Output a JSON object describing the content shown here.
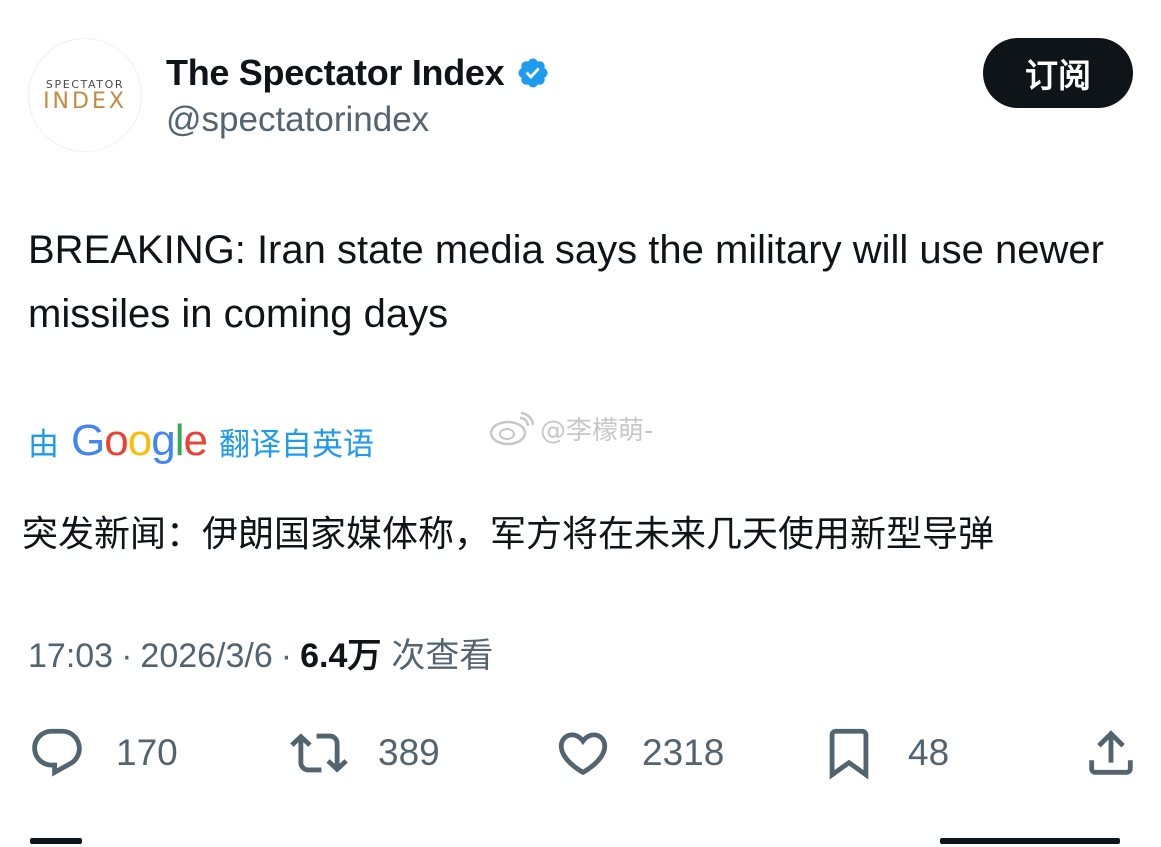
{
  "author": {
    "display_name": "The Spectator Index",
    "handle": "@spectatorindex",
    "avatar_line1": "SPECTATOR",
    "avatar_line2": "INDEX",
    "verified_icon": "verified-badge-icon",
    "avatar_accent_color": "#c8893f"
  },
  "subscribe_label": "订阅",
  "tweet": {
    "text": "BREAKING: Iran state media says the military will use newer missiles in coming days"
  },
  "translation": {
    "prefix": "由",
    "brand": "Google",
    "suffix": "翻译自英语",
    "text": "突发新闻：伊朗国家媒体称，军方将在未来几天使用新型导弹"
  },
  "watermark": {
    "text": "@李檬萌-",
    "icon": "weibo-icon"
  },
  "meta": {
    "time": "17:03",
    "separator": "·",
    "date": "2026/3/6",
    "views_count": "6.4万",
    "views_label": "次查看"
  },
  "actions": {
    "reply": {
      "icon": "reply-icon",
      "count": "170"
    },
    "retweet": {
      "icon": "retweet-icon",
      "count": "389"
    },
    "like": {
      "icon": "heart-icon",
      "count": "2318"
    },
    "bookmark": {
      "icon": "bookmark-icon",
      "count": "48"
    },
    "share": {
      "icon": "share-icon"
    }
  },
  "colors": {
    "link_blue": "#1d9bf0",
    "text_primary": "#0f1419",
    "text_secondary": "#536471",
    "button_dark": "#0f1419"
  }
}
